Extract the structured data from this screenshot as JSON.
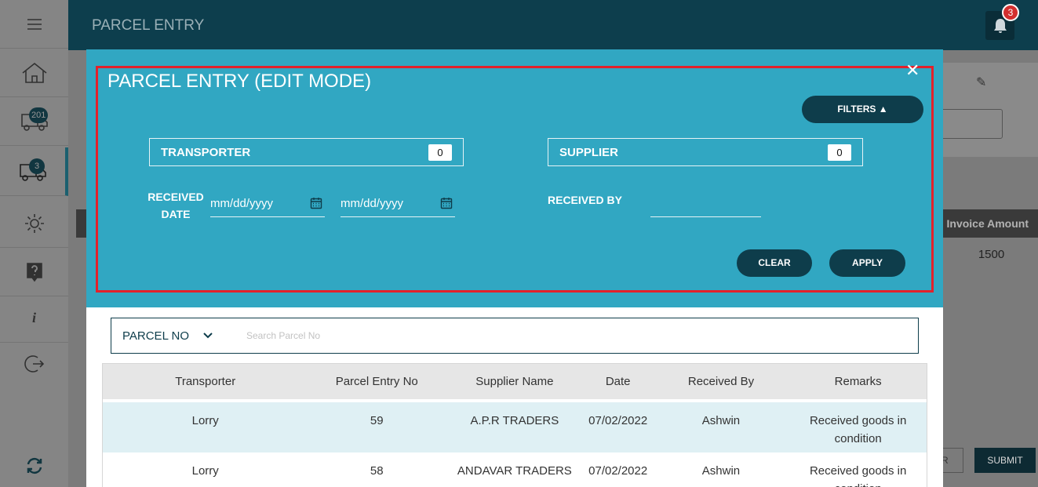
{
  "app": {
    "title": "PARCEL ENTRY",
    "notification_count": "3"
  },
  "sidebar": {
    "items": [
      {
        "name": "menu",
        "icon": "hamburger-icon"
      },
      {
        "name": "home",
        "icon": "home-icon"
      },
      {
        "name": "inward",
        "icon": "truck-icon",
        "badge": "201"
      },
      {
        "name": "parcel",
        "icon": "truck-icon",
        "badge": "3",
        "active": true
      },
      {
        "name": "settings",
        "icon": "gear-icon"
      },
      {
        "name": "help",
        "icon": "help-icon"
      },
      {
        "name": "info",
        "icon": "info-icon"
      },
      {
        "name": "logout",
        "icon": "logout-icon"
      },
      {
        "name": "sync",
        "icon": "sync-icon"
      }
    ]
  },
  "background": {
    "invoice_amount_header": "Invoice Amount",
    "invoice_amount_value": "1500",
    "partial_button_text": "R",
    "submit_label": "SUBMIT"
  },
  "modal": {
    "title": "PARCEL ENTRY (EDIT MODE)",
    "close_symbol": "✕",
    "filters_label": "FILTERS ▲",
    "transporter": {
      "label": "TRANSPORTER",
      "count": "0"
    },
    "supplier": {
      "label": "SUPPLIER",
      "count": "0"
    },
    "received_date_label": "RECEIVED DATE",
    "date_from_placeholder": "mm/dd/yyyy",
    "date_to_placeholder": "mm/dd/yyyy",
    "received_by_label": "RECEIVED BY",
    "received_by_value": "",
    "clear_label": "CLEAR",
    "apply_label": "APPLY"
  },
  "search": {
    "field_label": "PARCEL NO",
    "placeholder": "Search Parcel No",
    "value": ""
  },
  "table": {
    "headers": [
      "Transporter",
      "Parcel Entry No",
      "Supplier Name",
      "Date",
      "Received By",
      "Remarks"
    ],
    "rows": [
      [
        "Lorry",
        "59",
        "A.P.R TRADERS",
        "07/02/2022",
        "Ashwin",
        "Received goods in condition"
      ],
      [
        "Lorry",
        "58",
        "ANDAVAR TRADERS",
        "07/02/2022",
        "Ashwin",
        "Received goods in condition"
      ]
    ]
  },
  "colors": {
    "header_bg": "#0d3e4d",
    "modal_accent": "#31a7c2",
    "button_dark": "#0e3d4b",
    "highlight_border": "#e3212b",
    "row_highlight": "#dff0f4"
  }
}
